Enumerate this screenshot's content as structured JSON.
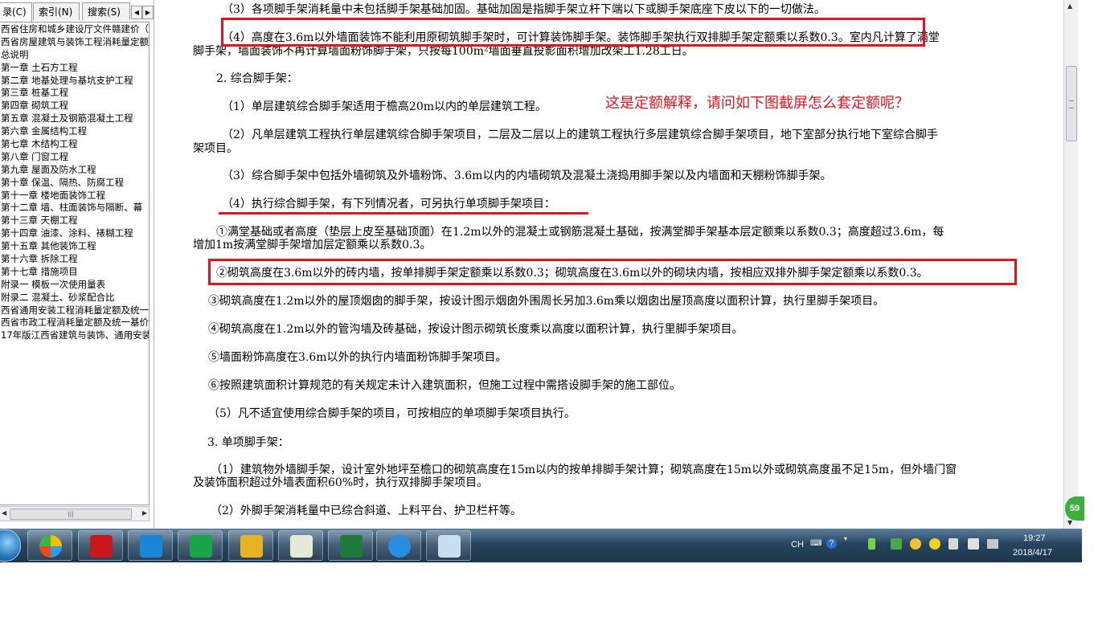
{
  "nav": {
    "tabs": [
      "录(C)",
      "索引(N)",
      "搜索(S)"
    ],
    "tree_items": [
      "西省住房和城乡建设厅文件赣建价（",
      "西省房屋建筑与装饰工程消耗量定额",
      "总说明",
      "第一章 土石方工程",
      "第二章 地基处理与基坑支护工程",
      "第三章 桩基工程",
      "第四章 砌筑工程",
      "第五章 混凝土及钢筋混凝土工程",
      "第六章 金属结构工程",
      "第七章 木结构工程",
      "第八章 门窗工程",
      "第九章 屋面及防水工程",
      "第十章 保温、隔热、防腐工程",
      "第十一章 楼地面装饰工程",
      "第十二章 墙、柱面装饰与隔断、幕",
      "第十三章 天棚工程",
      "第十四章 油漆、涂料、裱糊工程",
      "第十五章 其他装饰工程",
      "第十六章 拆除工程",
      "第十七章 措施项目",
      "附录一 模板一次使用量表",
      "附录二 混凝土、砂浆配合比",
      "西省通用安装工程消耗量定额及统一",
      "西省市政工程消耗量定额及统一基价",
      "17年版江西省建筑与装饰、通用安装"
    ]
  },
  "doc": {
    "lines": [
      "（3）各项脚手架消耗量中未包括脚手架基础加固。基础加固是指脚手架立杆下端以下或脚手架底座下皮以下的一切做法。",
      "（4）高度在3.6m以外墙面装饰不能利用原砌筑脚手架时，可计算装饰脚手架。装饰脚手架执行双排脚手架定额乘以系数0.3。室内凡计算了满堂",
      "脚手架，墙面装饰不再计算墙面粉饰脚手架，只按每100m²墙面垂直投影面积增加改架工1.28工日。",
      "2. 综合脚手架：",
      "（1）单层建筑综合脚手架适用于檐高20m以内的单层建筑工程。",
      "（2）凡单层建筑工程执行单层建筑综合脚手架项目，二层及二层以上的建筑工程执行多层建筑综合脚手架项目，地下室部分执行地下室综合脚手",
      "架项目。",
      "（3）综合脚手架中包括外墙砌筑及外墙粉饰、3.6m以内的内墙砌筑及混凝土浇捣用脚手架以及内墙面和天棚粉饰脚手架。",
      "（4）执行综合脚手架，有下列情况者，可另执行单项脚手架项目：",
      "①满堂基础或者高度（垫层上皮至基础顶面）在1.2m以外的混凝土或钢筋混凝土基础，按满堂脚手架基本层定额乘以系数0.3；高度超过3.6m，每",
      "增加1m按满堂脚手架增加层定额乘以系数0.3。",
      "②砌筑高度在3.6m以外的砖内墙，按单排脚手架定额乘以系数0.3；砌筑高度在3.6m以外的砌块内墙，按相应双排外脚手架定额乘以系数0.3。",
      "③砌筑高度在1.2m以外的屋顶烟囱的脚手架，按设计图示烟囱外围周长另加3.6m乘以烟囱出屋顶高度以面积计算，执行里脚手架项目。",
      "④砌筑高度在1.2m以外的管沟墙及砖基础，按设计图示砌筑长度乘以高度以面积计算，执行里脚手架项目。",
      "⑤墙面粉饰高度在3.6m以外的执行内墙面粉饰脚手架项目。",
      "⑥按照建筑面积计算规范的有关规定未计入建筑面积，但施工过程中需搭设脚手架的施工部位。",
      "（5）凡不适宜使用综合脚手架的项目，可按相应的单项脚手架项目执行。",
      "3. 单项脚手架：",
      "（1）建筑物外墙脚手架，设计室外地坪至檐口的砌筑高度在15m以内的按单排脚手架计算；砌筑高度在15m以外或砌筑高度虽不足15m，但外墙门窗",
      "及装饰面积超过外墙表面积60%时，执行双排脚手架项目。",
      "（2）外脚手架消耗量中已综合斜道、上料平台、护卫栏杆等。"
    ],
    "question": "这是定额解释，请问如下图截屏怎么套定额呢？",
    "highlight_color": "#e0151f"
  },
  "scroll_badge": "59",
  "taskbar": {
    "apps": [
      "360-icon",
      "autocad-icon",
      "network-icon",
      "glodon-icon",
      "notes-icon",
      "help-doc-icon",
      "excel-icon",
      "ie-icon",
      "paint-icon"
    ],
    "tray_lang": "CH",
    "time": "19:27",
    "date": "2018/4/17"
  }
}
